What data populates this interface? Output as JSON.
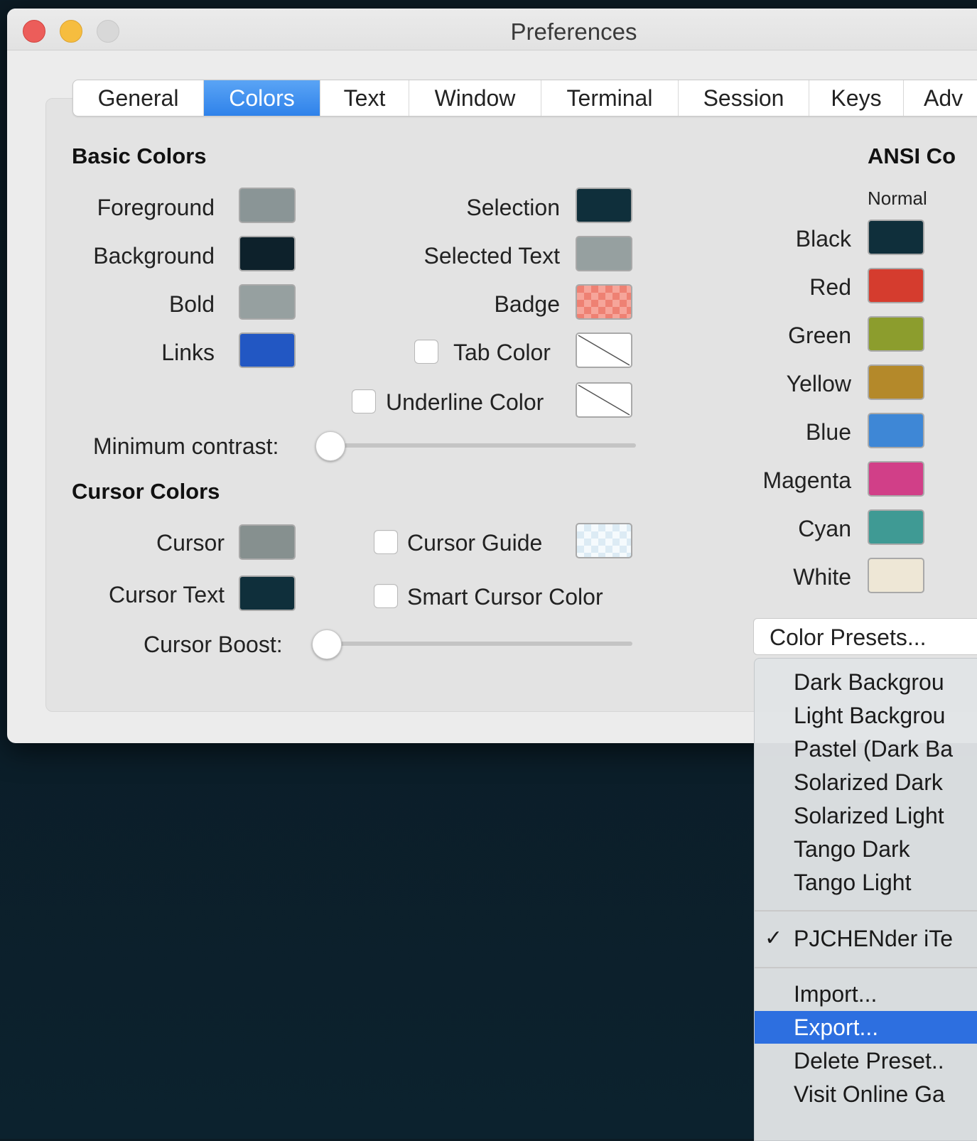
{
  "window": {
    "title": "Preferences"
  },
  "tabs": [
    "General",
    "Colors",
    "Text",
    "Window",
    "Terminal",
    "Session",
    "Keys",
    "Adv"
  ],
  "active_tab": "Colors",
  "basic_colors": {
    "heading": "Basic Colors",
    "left": [
      {
        "label": "Foreground",
        "color": "#8a9596"
      },
      {
        "label": "Background",
        "color": "#0d212b"
      },
      {
        "label": "Bold",
        "color": "#96a0a0"
      },
      {
        "label": "Links",
        "color": "#2257c3"
      }
    ],
    "right": [
      {
        "label": "Selection",
        "color": "#0f2f3b"
      },
      {
        "label": "Selected Text",
        "color": "#96a0a0"
      },
      {
        "label": "Badge",
        "color": "#f28c80"
      }
    ],
    "tab_color": {
      "label": "Tab Color",
      "checked": false
    },
    "underline_color": {
      "label": "Underline Color",
      "checked": false
    },
    "min_contrast_label": "Minimum contrast:",
    "min_contrast_value": 0
  },
  "cursor_colors": {
    "heading": "Cursor Colors",
    "cursor": {
      "label": "Cursor",
      "color": "#86908f"
    },
    "cursor_text": {
      "label": "Cursor Text",
      "color": "#0f2f3b"
    },
    "cursor_guide": {
      "label": "Cursor Guide",
      "checked": false,
      "color": "#d6eaf5"
    },
    "smart_cursor": {
      "label": "Smart Cursor Color",
      "checked": false
    },
    "boost_label": "Cursor Boost:",
    "boost_value": 0
  },
  "ansi": {
    "heading": "ANSI Co",
    "column": "Normal",
    "colors": [
      {
        "label": "Black",
        "color": "#0f2f3b"
      },
      {
        "label": "Red",
        "color": "#d53c2e"
      },
      {
        "label": "Green",
        "color": "#8c9d2d"
      },
      {
        "label": "Yellow",
        "color": "#b4892a"
      },
      {
        "label": "Blue",
        "color": "#3e87d6"
      },
      {
        "label": "Magenta",
        "color": "#d13f88"
      },
      {
        "label": "Cyan",
        "color": "#3f9a94"
      },
      {
        "label": "White",
        "color": "#eee7d6"
      }
    ]
  },
  "presets": {
    "button": "Color Presets...",
    "menu_builtin": [
      "Dark Backgrou",
      "Light Backgrou",
      "Pastel (Dark Ba",
      "Solarized Dark",
      "Solarized Light",
      "Tango Dark",
      "Tango Light"
    ],
    "menu_custom": {
      "label": "PJCHENder iTe",
      "check": "✓"
    },
    "menu_actions": [
      "Import...",
      "Export...",
      "Delete Preset..",
      "Visit Online Ga"
    ],
    "highlighted": "Export..."
  }
}
